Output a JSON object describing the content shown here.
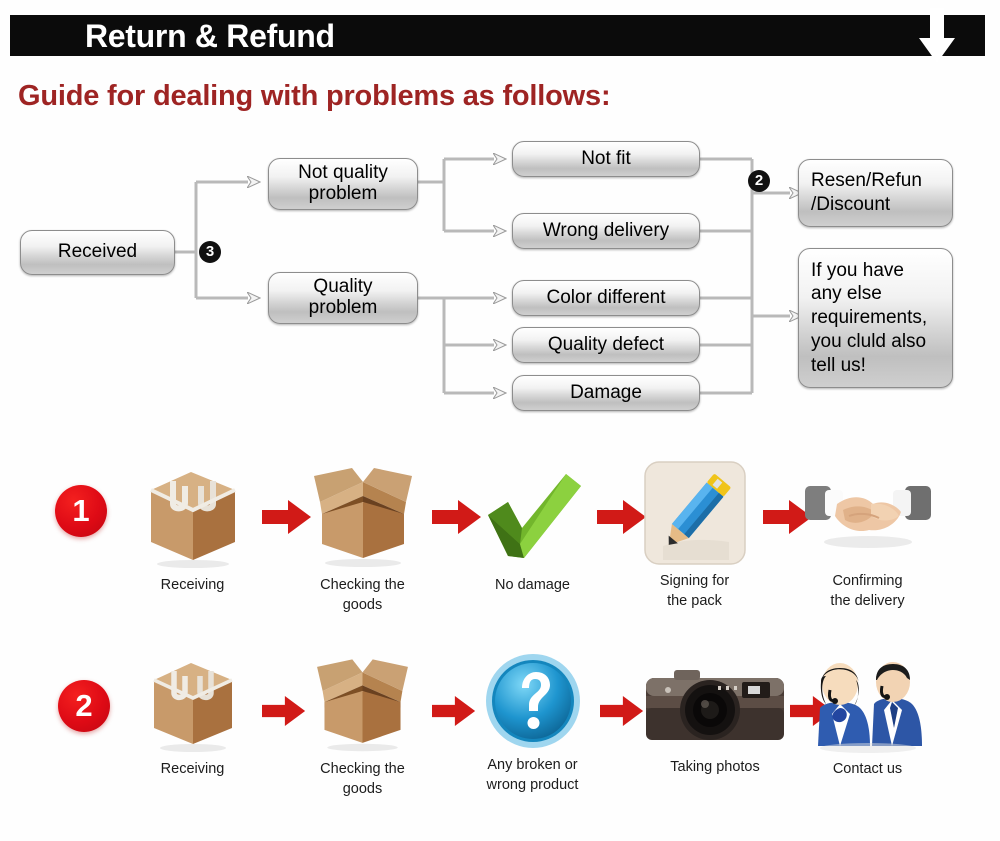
{
  "header": {
    "title": "Return & Refund",
    "arrow_icon": "down-arrow-icon"
  },
  "guide": {
    "title": "Guide for dealing with problems as follows:"
  },
  "colors": {
    "header_bg": "#0b0b0b",
    "header_text": "#ffffff",
    "guide_title": "#9e2423",
    "step_number_red": "#de0a15",
    "arrow_red": "#d11a17",
    "box_border": "#8d8d8d",
    "page_bg": "#fefefe"
  },
  "flowchart": {
    "start": {
      "label": "Received"
    },
    "badges": [
      {
        "id": "badge-3",
        "label": "3"
      },
      {
        "id": "badge-2",
        "label": "2"
      }
    ],
    "categories": [
      {
        "id": "not-quality-problem",
        "label": "Not quality\nproblem"
      },
      {
        "id": "quality-problem",
        "label": "Quality\nproblem"
      }
    ],
    "issues": [
      {
        "id": "not-fit",
        "label": "Not fit"
      },
      {
        "id": "wrong-delivery",
        "label": "Wrong delivery"
      },
      {
        "id": "color-different",
        "label": "Color different"
      },
      {
        "id": "quality-defect",
        "label": "Quality defect"
      },
      {
        "id": "damage",
        "label": "Damage"
      }
    ],
    "outcomes": [
      {
        "id": "resend-refund-discount",
        "label": "Resen/Refun\n/Discount"
      },
      {
        "id": "other-requirements",
        "label": "If you have\nany else\nrequirements,\nyou cluld also\ntell us!"
      }
    ]
  },
  "steps": [
    {
      "number": "1",
      "cells": [
        {
          "id": "receiving",
          "icon": "sealed-box-icon",
          "label": "Receiving"
        },
        {
          "id": "checking-the-goods",
          "icon": "open-box-icon",
          "label": "Checking the\ngoods"
        },
        {
          "id": "no-damage",
          "icon": "green-check-icon",
          "label": "No damage"
        },
        {
          "id": "signing-for-the-pack",
          "icon": "pencil-signing-icon",
          "label": "Signing for\nthe pack"
        },
        {
          "id": "confirming-the-delivery",
          "icon": "handshake-icon",
          "label": "Confirming\nthe delivery"
        }
      ]
    },
    {
      "number": "2",
      "cells": [
        {
          "id": "receiving-2",
          "icon": "sealed-box-icon",
          "label": "Receiving"
        },
        {
          "id": "checking-the-goods-2",
          "icon": "open-box-icon",
          "label": "Checking the\ngoods"
        },
        {
          "id": "any-broken-or-wrong-product",
          "icon": "question-mark-icon",
          "label": "Any broken or\nwrong product"
        },
        {
          "id": "taking-photos",
          "icon": "camera-icon",
          "label": "Taking photos"
        },
        {
          "id": "contact-us",
          "icon": "support-agents-icon",
          "label": "Contact us"
        }
      ]
    }
  ]
}
